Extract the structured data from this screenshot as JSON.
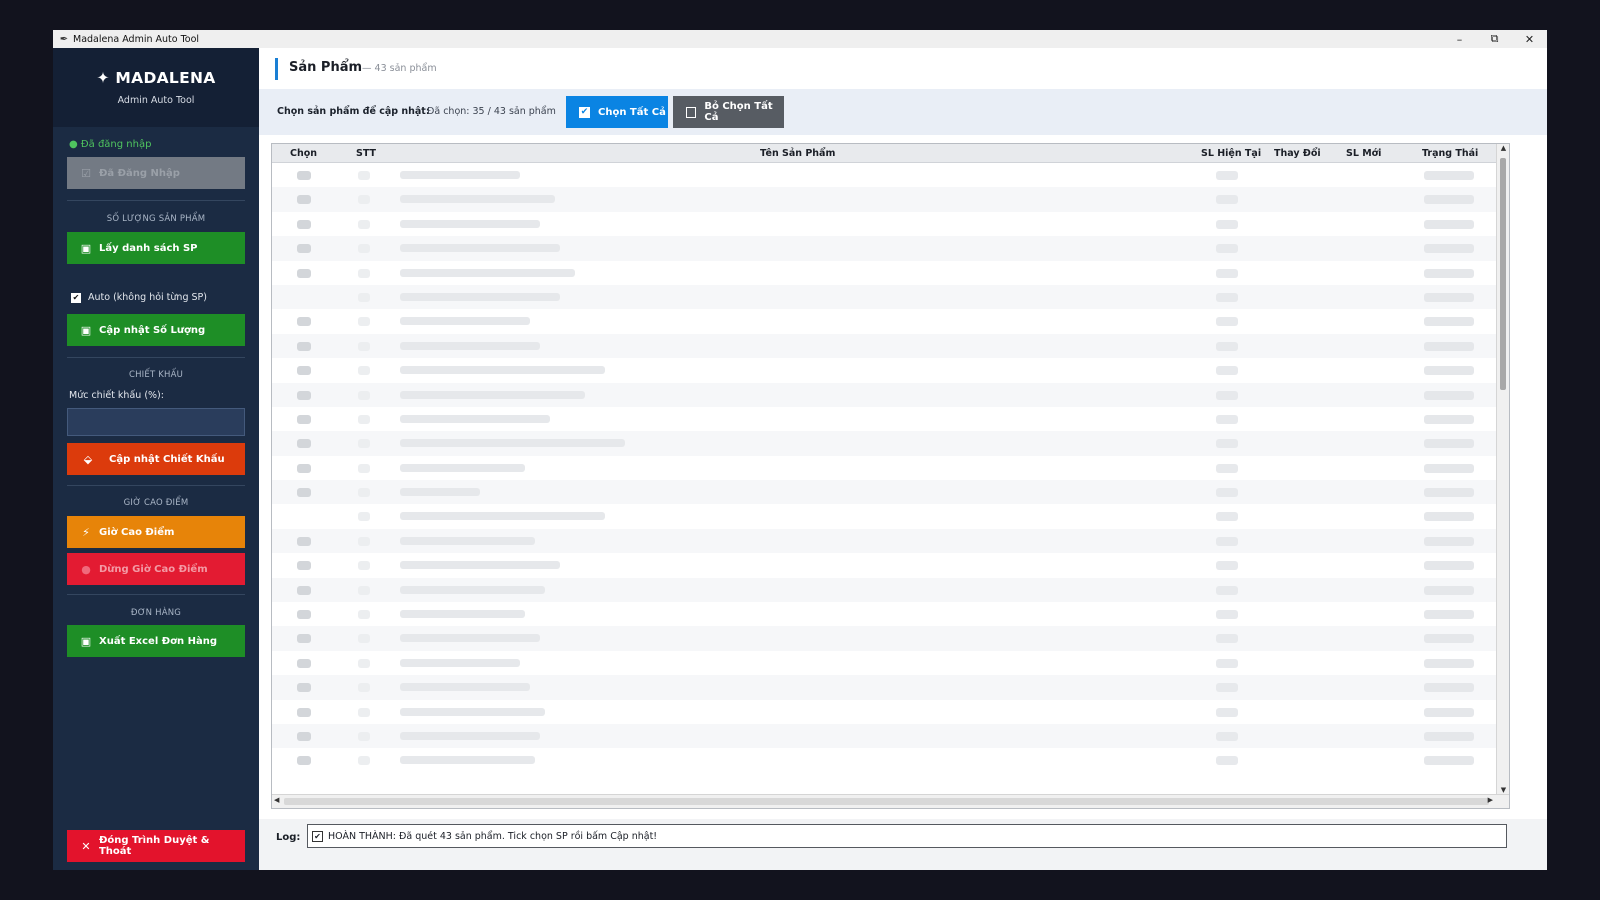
{
  "window": {
    "title": "Madalena Admin Auto Tool",
    "controls": {
      "minimize": "–",
      "restore": "⧉",
      "close": "✕"
    }
  },
  "sidebar": {
    "brand": {
      "logo": "✦ MADALENA",
      "subtitle": "Admin Auto Tool"
    },
    "status": "● Đã đăng nhập",
    "login_button": {
      "icon": "☑",
      "label": "Đã Đăng Nhập"
    },
    "section_quantity": "SỐ LƯỢNG SẢN PHẨM",
    "get_list_button": {
      "icon": "💾",
      "label": "Lấy danh sách SP"
    },
    "auto_checkbox": {
      "checked": true,
      "mark": "✔",
      "label": "Auto (không hỏi từng SP)"
    },
    "update_qty_button": {
      "icon": "💾",
      "label": "Cập nhật Số Lượng"
    },
    "section_discount": "CHIẾT KHẤU",
    "discount_label": "Mức chiết khấu (%):",
    "discount_input": {
      "value": ""
    },
    "update_discount_button": {
      "icon": "🏷",
      "label": "Cập nhật Chiết Khấu"
    },
    "section_peak": "GIỜ CAO ĐIỂM",
    "peak_button": {
      "icon": "⚡",
      "label": "Giờ Cao Điểm"
    },
    "stop_peak_button": {
      "icon": "●",
      "label": "Dừng Giờ Cao Điểm"
    },
    "section_orders": "ĐƠN HÀNG",
    "export_button": {
      "icon": "💾",
      "label": "Xuất Excel Đơn Hàng"
    },
    "exit_button": {
      "icon": "✕",
      "label": "Đóng Trình Duyệt & Thoát"
    }
  },
  "main": {
    "title": "Sản Phẩm",
    "count": "— 43 sản phẩm",
    "toolbar": {
      "label": "Chọn sản phẩm để cập nhật:",
      "selected": "Đã chọn: 35 / 43 sản phẩm",
      "select_all": {
        "icon": "✔",
        "label": "Chọn Tất Cả"
      },
      "deselect_all": {
        "icon": "",
        "label": "Bỏ Chọn Tất Cả"
      }
    },
    "table": {
      "columns": [
        "Chọn",
        "STT",
        "Tên Sản Phẩm",
        "SL Hiện Tại",
        "Thay Đổi",
        "SL Mới",
        "Trạng Thái"
      ],
      "rows_note_hidden": true
    },
    "log": {
      "label": "Log:",
      "icon": "✔",
      "message": "HOÀN THÀNH: Đã quét 43 sản phẩm. Tick chọn SP rồi bấm Cập nhật!"
    }
  },
  "colors": {
    "sidebar_bg": "#1b2b43",
    "green": "#1e8e26",
    "orange": "#e78409",
    "red": "#e31b32",
    "blue": "#0a84e3"
  }
}
